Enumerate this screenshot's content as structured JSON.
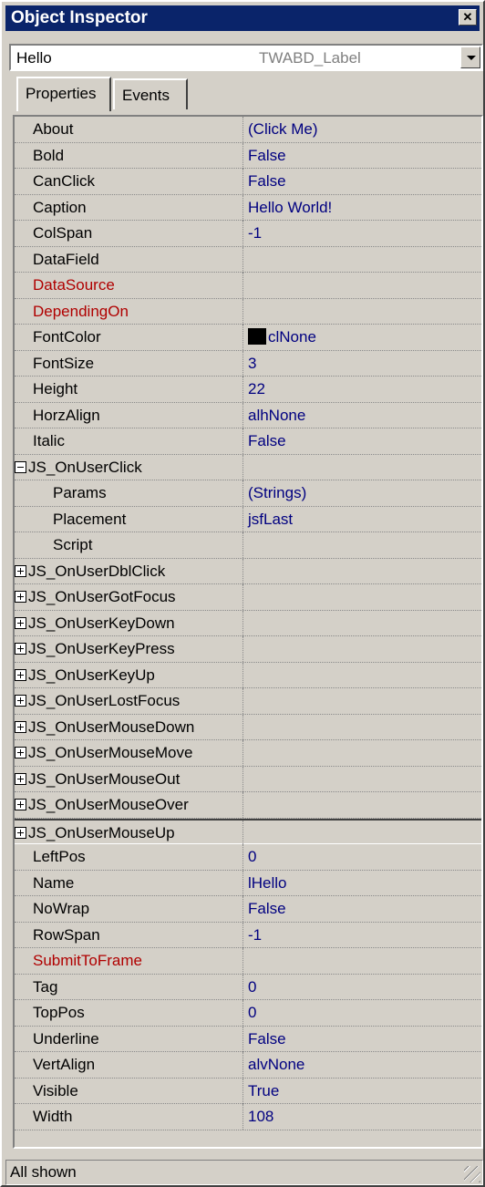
{
  "window": {
    "title": "Object Inspector"
  },
  "selector": {
    "object_name": "Hello",
    "object_class": "TWABD_Label"
  },
  "tabs": [
    {
      "label": "Properties"
    },
    {
      "label": "Events"
    }
  ],
  "properties": [
    {
      "name": "About",
      "value": "(Click Me)"
    },
    {
      "name": "Bold",
      "value": "False"
    },
    {
      "name": "CanClick",
      "value": "False"
    },
    {
      "name": "Caption",
      "value": "Hello World!"
    },
    {
      "name": "ColSpan",
      "value": "-1"
    },
    {
      "name": "DataField",
      "value": ""
    },
    {
      "name": "DataSource",
      "value": ""
    },
    {
      "name": "DependingOn",
      "value": ""
    },
    {
      "name": "FontColor",
      "value": "clNone"
    },
    {
      "name": "FontSize",
      "value": "3"
    },
    {
      "name": "Height",
      "value": "22"
    },
    {
      "name": "HorzAlign",
      "value": "alhNone"
    },
    {
      "name": "Italic",
      "value": "False"
    },
    {
      "name": "JS_OnUserClick",
      "value": ""
    },
    {
      "name": "Params",
      "value": "(Strings)"
    },
    {
      "name": "Placement",
      "value": "jsfLast"
    },
    {
      "name": "Script",
      "value": ""
    },
    {
      "name": "JS_OnUserDblClick",
      "value": ""
    },
    {
      "name": "JS_OnUserGotFocus",
      "value": ""
    },
    {
      "name": "JS_OnUserKeyDown",
      "value": ""
    },
    {
      "name": "JS_OnUserKeyPress",
      "value": ""
    },
    {
      "name": "JS_OnUserKeyUp",
      "value": ""
    },
    {
      "name": "JS_OnUserLostFocus",
      "value": ""
    },
    {
      "name": "JS_OnUserMouseDown",
      "value": ""
    },
    {
      "name": "JS_OnUserMouseMove",
      "value": ""
    },
    {
      "name": "JS_OnUserMouseOut",
      "value": ""
    },
    {
      "name": "JS_OnUserMouseOver",
      "value": ""
    },
    {
      "name": "JS_OnUserMouseUp",
      "value": ""
    },
    {
      "name": "LeftPos",
      "value": "0"
    },
    {
      "name": "Name",
      "value": "lHello"
    },
    {
      "name": "NoWrap",
      "value": "False"
    },
    {
      "name": "RowSpan",
      "value": "-1"
    },
    {
      "name": "SubmitToFrame",
      "value": ""
    },
    {
      "name": "Tag",
      "value": "0"
    },
    {
      "name": "TopPos",
      "value": "0"
    },
    {
      "name": "Underline",
      "value": "False"
    },
    {
      "name": "VertAlign",
      "value": "alvNone"
    },
    {
      "name": "Visible",
      "value": "True"
    },
    {
      "name": "Width",
      "value": "108"
    }
  ],
  "colors": {
    "title_bg": "#0a246a",
    "value_text": "#000080",
    "required_text": "#b00000",
    "font_color_swatch": "#000000"
  },
  "status": {
    "text": "All shown"
  }
}
